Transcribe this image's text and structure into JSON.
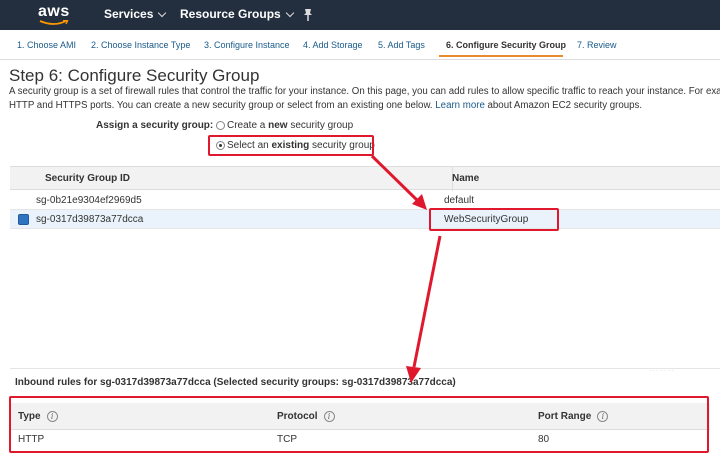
{
  "nav": {
    "logo_text": "aws",
    "services_label": "Services",
    "resource_groups_label": "Resource Groups"
  },
  "steps": [
    {
      "label": "1. Choose AMI",
      "active": false
    },
    {
      "label": "2. Choose Instance Type",
      "active": false
    },
    {
      "label": "3. Configure Instance",
      "active": false
    },
    {
      "label": "4. Add Storage",
      "active": false
    },
    {
      "label": "5. Add Tags",
      "active": false
    },
    {
      "label": "6. Configure Security Group",
      "active": true
    },
    {
      "label": "7. Review",
      "active": false
    }
  ],
  "page": {
    "title": "Step 6: Configure Security Group",
    "desc_line1": "A security group is a set of firewall rules that control the traffic for your instance. On this page, you can add rules to allow specific traffic to reach your instance. For exa",
    "desc_line2_pre": "HTTP and HTTPS ports. You can create a new security group or select from an existing one below. ",
    "desc_link": "Learn more",
    "desc_line2_post": " about Amazon EC2 security groups."
  },
  "assign": {
    "label": "Assign a security group:",
    "option_new_pre": "Create a ",
    "option_new_bold": "new",
    "option_new_post": " security group",
    "option_existing_pre": "Select an ",
    "option_existing_bold": "existing",
    "option_existing_post": " security group",
    "selected": "existing"
  },
  "sg_table": {
    "headers": {
      "id": "Security Group ID",
      "name": "Name"
    },
    "rows": [
      {
        "id": "sg-0b21e9304ef2969d5",
        "name": "default",
        "selected": false
      },
      {
        "id": "sg-0317d39873a77dcca",
        "name": "WebSecurityGroup",
        "selected": true
      }
    ]
  },
  "inbound": {
    "title": "Inbound rules for sg-0317d39873a77dcca (Selected security groups: sg-0317d39873a77dcca)",
    "headers": {
      "type": "Type",
      "protocol": "Protocol",
      "port_range": "Port Range"
    },
    "rows": [
      {
        "type": "HTTP",
        "protocol": "TCP",
        "port_range": "80"
      }
    ]
  },
  "colors": {
    "nav_bg": "#232f3e",
    "accent_orange": "#e88b2e",
    "annotation_red": "#e0182e",
    "link_blue": "#1a5a8a"
  }
}
